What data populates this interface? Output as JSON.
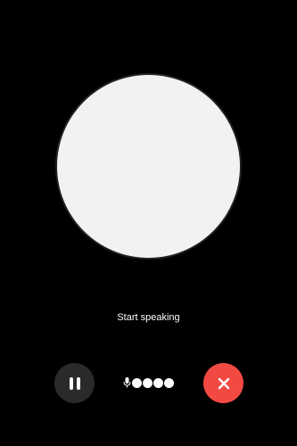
{
  "colors": {
    "background": "#000000",
    "orb": "#f2f2f2",
    "orb_border": "#222222",
    "status_text": "#ffffff",
    "pause_button_bg": "#2a2a2a",
    "pause_icon": "#ffffff",
    "level_dot": "#ffffff",
    "end_button_bg": "#f24a43",
    "end_icon": "#ffffff"
  },
  "orb": {
    "icon": "speaking-orb"
  },
  "status": {
    "text": "Start speaking"
  },
  "controls": {
    "pause": {
      "icon": "pause-icon"
    },
    "audio_indicator": {
      "icon": "microphone-icon",
      "level_dot_count": 4
    },
    "end": {
      "icon": "close-icon"
    }
  }
}
